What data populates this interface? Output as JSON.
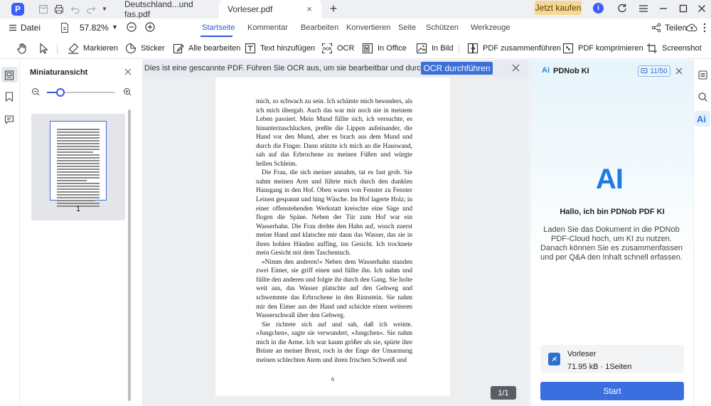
{
  "titlebar": {
    "app_logo": "P",
    "tabs": [
      {
        "label": "Deutschland...und fas.pdf",
        "active": false
      },
      {
        "label": "Vorleser.pdf",
        "active": true
      }
    ],
    "tab_close_glyph": "×",
    "new_tab_glyph": "+",
    "buy_label": "Jetzt kaufen",
    "info_glyph": "i"
  },
  "menubar": {
    "file_label": "Datei",
    "zoom_value": "57.82%",
    "main_tabs": [
      {
        "label": "Startseite",
        "active": true
      },
      {
        "label": "Kommentar"
      },
      {
        "label": "Bearbeiten"
      },
      {
        "label": "Konvertieren"
      },
      {
        "label": "Seite"
      },
      {
        "label": "Schützen"
      },
      {
        "label": "Werkzeuge"
      }
    ],
    "share_label": "Teilen"
  },
  "toolbar": {
    "tools": [
      {
        "label": "Markieren",
        "icon": "highlighter-icon"
      },
      {
        "label": "Sticker",
        "icon": "sticker-icon"
      },
      {
        "label": "Alle bearbeiten",
        "icon": "edit-all-icon"
      },
      {
        "label": "Text hinzufügen",
        "icon": "add-text-icon"
      },
      {
        "label": "OCR",
        "icon": "ocr-icon"
      },
      {
        "label": "In Office",
        "icon": "to-office-icon"
      },
      {
        "label": "In Bild",
        "icon": "to-image-icon"
      },
      {
        "label": "PDF zusammenführen",
        "icon": "merge-icon"
      },
      {
        "label": "PDF komprimieren",
        "icon": "compress-icon"
      },
      {
        "label": "Screenshot",
        "icon": "screenshot-icon"
      }
    ]
  },
  "thumbnails": {
    "title": "Miniaturansicht",
    "zoom_level": 0.2,
    "pages": [
      {
        "number": "1"
      }
    ]
  },
  "ocr_banner": {
    "message": "Dies ist eine gescannte PDF. Führen Sie OCR aus, um sie bearbeitbar und durchsucht",
    "button_label": "OCR durchführen"
  },
  "document": {
    "paragraphs": [
      {
        "indent": false,
        "text": "mich, so schwach zu sein. Ich schämte mich besonders, als ich mich übergab. Auch das war mir noch nie in meinem Leben passiert. Mein Mund füllte sich, ich versuchte, es hinunterzuschlucken, preßte die Lippen aufeinander, die Hand vor den Mund, aber es brach aus dem Mund und durch die Finger. Dann stützte ich mich an die Hauswand, sah auf das Erbrochene zu meinen Füßen und würgte hellen Schleim."
      },
      {
        "indent": true,
        "text": "Die Frau, die sich meiner annahm, tat es fast grob. Sie nahm meinen Arm und führte mich durch den dunklen Hausgang in den Hof. Oben waren von Fenster zu Fenster Leinen gespannt und hing Wäsche. Im Hof lagerte Holz; in einer offenstehenden Werkstatt kreischte eine Säge und flogen die Späne. Neben der Tür zum Hof war ein Wasserhahn. Die Frau drehte den Hahn auf, wusch zuerst meine Hand und klatschte mir dann das Wasser, das sie in ihren hohlen Händen auffing, ins Gesicht. Ich trocknete mein Gesicht mit dem Taschentuch."
      },
      {
        "indent": true,
        "text": "»Nimm den anderen!« Neben dem Wasserhahn standen zwei Eimer, sie griff einen und füllte ihn. Ich nahm und füllte den anderen und folgte ihr durch den Gang. Sie holte weit aus, das Wasser platschte auf den Gehweg und schwemmte das Erbrochene in den Rinnstein. Sie nahm mir den Eimer aus der Hand und schickte einen weiteren Wasserschwall über den Gehweg."
      },
      {
        "indent": true,
        "text": "Sie richtete sich auf und sah, daß ich weinte. »Jungchen«, sagte sie verwundert, »Jungchen«. Sie nahm mich in die Arme. Ich war kaum größer als sie, spürte ihre Brüste an meiner Brust, roch in der Enge der Umarmung meinen schlechten Atem und ihren frischen Schweiß und"
      }
    ],
    "page_number": "6",
    "page_counter": "1/1"
  },
  "ai_panel": {
    "logo": "Ai",
    "title": "PDNob KI",
    "usage": "11/50",
    "big_logo": "AI",
    "hello": "Hallo, ich bin PDNob PDF KI",
    "description": "Laden Sie das Dokument in die PDNob PDF-Cloud hoch, um KI zu nutzen. Danach können Sie es zusammenfassen und per Q&A den Inhalt schnell erfassen.",
    "file": {
      "name": "Vorleser",
      "meta": "71.95 kB · 1Seiten"
    },
    "start_label": "Start"
  },
  "right_rail": {
    "ai_label": "Ai"
  },
  "colors": {
    "accent": "#2f5bd7",
    "buy": "#f7d796",
    "ai": "#1e7be0"
  }
}
